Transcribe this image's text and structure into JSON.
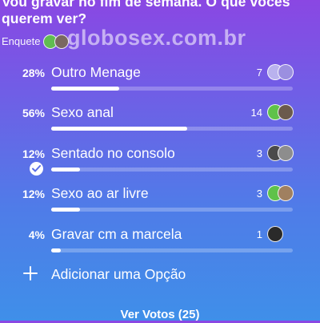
{
  "poll": {
    "question": "Vou gravar no fim de semana. O que vocês querem ver?",
    "type_label": "Enquete",
    "watermark": "globosex.com.br",
    "options": [
      {
        "percent": "28%",
        "percent_value": 28,
        "label": "Outro Menage",
        "votes": "7",
        "voted": false,
        "voter_colors": [
          "#b9b2ee",
          "#9b8fe0"
        ]
      },
      {
        "percent": "56%",
        "percent_value": 56,
        "label": "Sexo anal",
        "votes": "14",
        "voted": false,
        "voter_colors": [
          "#5fc24a",
          "#6b5a4c"
        ]
      },
      {
        "percent": "12%",
        "percent_value": 12,
        "label": "Sentado no consolo",
        "votes": "3",
        "voted": true,
        "voter_colors": [
          "#4a4a4a",
          "#8d8d8d"
        ]
      },
      {
        "percent": "12%",
        "percent_value": 12,
        "label": "Sexo ao ar livre",
        "votes": "3",
        "voted": false,
        "voter_colors": [
          "#5fc24a",
          "#a08060"
        ]
      },
      {
        "percent": "4%",
        "percent_value": 4,
        "label": "Gravar cm a marcela",
        "votes": "1",
        "voted": false,
        "voter_colors": [
          "#2a2a2a"
        ]
      }
    ],
    "add_option_label": "Adicionar uma Opção",
    "view_votes_label": "Ver Votos (25)"
  },
  "icons": {
    "check": "check-icon",
    "plus": "plus-icon"
  },
  "colors": {
    "gradient_top": "#8a47e3",
    "gradient_bottom": "#3f8fe9",
    "bar_fill": "#ffffff",
    "check_mark": "#5b6fe6"
  }
}
